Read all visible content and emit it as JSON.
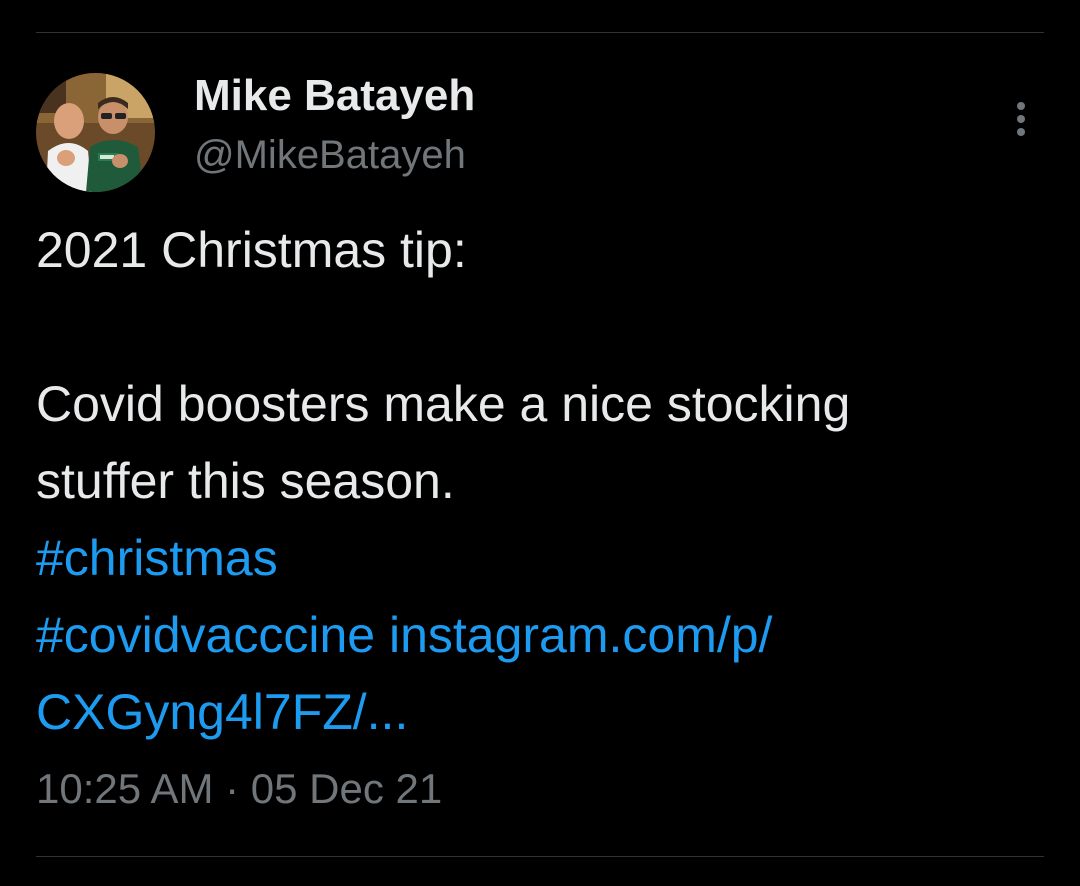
{
  "tweet": {
    "author": {
      "display_name": "Mike Batayeh",
      "handle": "@MikeBatayeh"
    },
    "more_icon": "more-vertical-icon",
    "body": {
      "line1": "2021 Christmas tip:",
      "line2": "Covid boosters make a nice stocking",
      "line3": "stuffer this season.",
      "hashtag1": "#christmas",
      "hashtag2": "#covidvacccine",
      "link_part1": "instagram.com/p/",
      "link_part2": "CXGyng4l7FZ/..."
    },
    "timestamp": "10:25 AM · 05 Dec 21"
  },
  "colors": {
    "background": "#000000",
    "text": "#e7e9ea",
    "secondary": "#71767b",
    "link": "#1d9bf0",
    "divider": "#2f3336"
  }
}
